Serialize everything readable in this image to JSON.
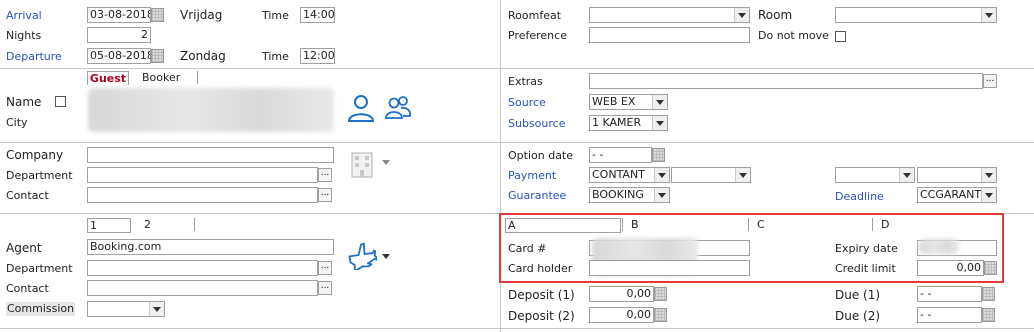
{
  "stay": {
    "arrival_label": "Arrival",
    "arrival_value": "03-08-2018",
    "arrival_day": "Vrijdag",
    "arrival_time_label": "Time",
    "arrival_time": "14:00",
    "nights_label": "Nights",
    "nights_value": "2",
    "departure_label": "Departure",
    "departure_value": "05-08-2018",
    "departure_day": "Zondag",
    "departure_time_label": "Time",
    "departure_time": "12:00"
  },
  "room": {
    "roomfeat_label": "Roomfeat",
    "room_label": "Room",
    "preference_label": "Preference",
    "do_not_move_label": "Do not move"
  },
  "guest": {
    "tab_guest": "Guest",
    "tab_booker": "Booker",
    "name_label": "Name",
    "city_label": "City"
  },
  "source": {
    "extras_label": "Extras",
    "source_label": "Source",
    "source_value": "WEB EX",
    "subsource_label": "Subsource",
    "subsource_value": "1 KAMER"
  },
  "company": {
    "company_label": "Company",
    "department_label": "Department",
    "contact_label": "Contact"
  },
  "payment": {
    "option_date_label": "Option date",
    "option_date_value": "-  -",
    "payment_label": "Payment",
    "payment_value": "CONTANT",
    "guarantee_label": "Guarantee",
    "guarantee_value": "BOOKING",
    "deadline_label": "Deadline",
    "deadline_value": "CCGARANT"
  },
  "agent": {
    "tab_1": "1",
    "tab_2": "2",
    "agent_label": "Agent",
    "agent_value": "Booking.com",
    "department_label": "Department",
    "contact_label": "Contact",
    "commission_label": "Commission"
  },
  "card": {
    "tab_a": "A",
    "tab_b": "B",
    "tab_c": "C",
    "tab_d": "D",
    "card_no_label": "Card #",
    "card_holder_label": "Card holder",
    "expiry_label": "Expiry date",
    "credit_limit_label": "Credit limit",
    "credit_limit_value": "0,00"
  },
  "deposit": {
    "deposit1_label": "Deposit (1)",
    "deposit1_value": "0,00",
    "deposit2_label": "Deposit (2)",
    "deposit2_value": "0,00",
    "due1_label": "Due (1)",
    "due1_value": "-  -",
    "due2_label": "Due (2)",
    "due2_value": "-  -"
  },
  "colors": {
    "label_blue": "#2a52be",
    "highlight_red": "#e53935",
    "guest_tab_red": "#b00020",
    "icon_blue": "#1e6fc8"
  }
}
